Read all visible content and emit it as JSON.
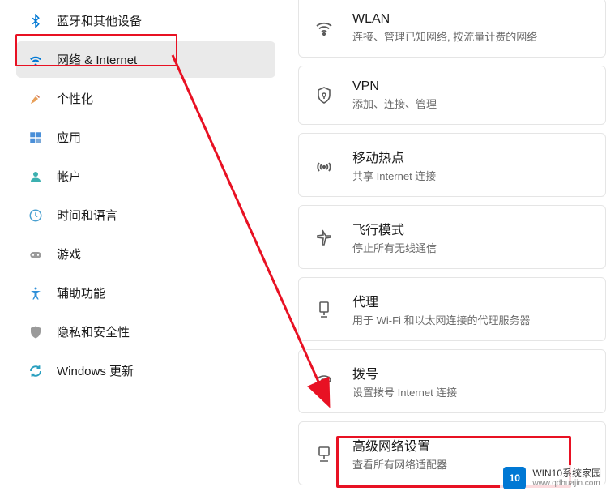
{
  "sidebar": {
    "items": [
      {
        "label": "蓝牙和其他设备",
        "icon": "bluetooth"
      },
      {
        "label": "网络 & Internet",
        "icon": "wifi",
        "selected": true
      },
      {
        "label": "个性化",
        "icon": "brush"
      },
      {
        "label": "应用",
        "icon": "apps"
      },
      {
        "label": "帐户",
        "icon": "person"
      },
      {
        "label": "时间和语言",
        "icon": "time"
      },
      {
        "label": "游戏",
        "icon": "gamepad"
      },
      {
        "label": "辅助功能",
        "icon": "accessibility"
      },
      {
        "label": "隐私和安全性",
        "icon": "shield"
      },
      {
        "label": "Windows 更新",
        "icon": "update"
      }
    ]
  },
  "cards": [
    {
      "title": "WLAN",
      "sub": "连接、管理已知网络, 按流量计费的网络",
      "icon": "wifi"
    },
    {
      "title": "VPN",
      "sub": "添加、连接、管理",
      "icon": "vpn-shield"
    },
    {
      "title": "移动热点",
      "sub": "共享 Internet 连接",
      "icon": "hotspot"
    },
    {
      "title": "飞行模式",
      "sub": "停止所有无线通信",
      "icon": "airplane"
    },
    {
      "title": "代理",
      "sub": "用于 Wi-Fi 和以太网连接的代理服务器",
      "icon": "proxy"
    },
    {
      "title": "拨号",
      "sub": "设置拨号 Internet 连接",
      "icon": "dial"
    },
    {
      "title": "高级网络设置",
      "sub": "查看所有网络适配器",
      "icon": "ethernet"
    }
  ],
  "watermark": {
    "logo_text": "10",
    "line1": "WIN10系统家园",
    "line2": "www.qdhuajin.com"
  }
}
